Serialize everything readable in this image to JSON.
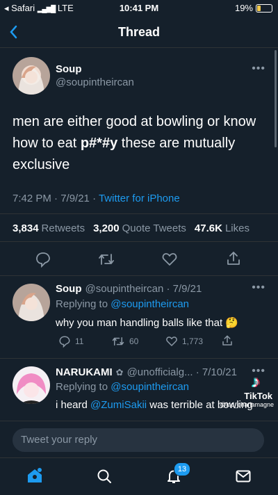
{
  "status_bar": {
    "carrier": "◂ Safari",
    "network": "LTE",
    "time": "10:41 PM",
    "battery": "19%"
  },
  "header": {
    "title": "Thread"
  },
  "main_tweet": {
    "name": "Soup",
    "handle": "@soupintheircan",
    "text_before": "men are either good at bowling or know how to eat ",
    "text_censored": "p#*#y",
    "text_after": " these are mutually exclusive",
    "time": "7:42 PM · 7/9/21 · ",
    "source": "Twitter for iPhone",
    "retweets_count": "3,834",
    "retweets_label": "Retweets",
    "quotes_count": "3,200",
    "quotes_label": "Quote Tweets",
    "likes_count": "47.6K",
    "likes_label": "Likes"
  },
  "replies": [
    {
      "name": "Soup",
      "handle_date": "@soupintheircan · 7/9/21",
      "replying_label": "Replying to ",
      "replying_to": "@soupintheircan",
      "text": "why you man handling balls like that 🤔",
      "reply_count": "11",
      "retweet_count": "60",
      "like_count": "1,773"
    },
    {
      "name": "NARUKAMI",
      "handle_date": "@unofficialg... · 7/10/21",
      "replying_label": "Replying to ",
      "replying_to": "@soupintheircan",
      "text_before": "i heard ",
      "mention": "@ZumiSakii",
      "text_after": " was terrible at bowling"
    }
  ],
  "watermark": {
    "brand": "TikTok",
    "user": "@kid_charlamagne"
  },
  "compose": {
    "placeholder": "Tweet your reply"
  },
  "tabbar": {
    "notifications_badge": "13"
  },
  "colors": {
    "background": "#15202b",
    "accent": "#1d9bf0",
    "muted": "#8b98a5"
  }
}
